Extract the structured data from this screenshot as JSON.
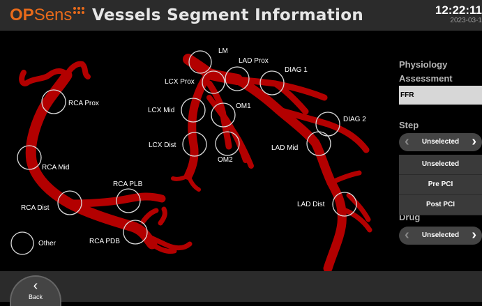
{
  "header": {
    "brand_op": "OP",
    "brand_sens": "Sens",
    "title": "Vessels Segment Information",
    "time": "12:22:11",
    "date": "2023-03-1"
  },
  "segments": [
    {
      "id": "lm",
      "label": "LM"
    },
    {
      "id": "lad-prox",
      "label": "LAD Prox"
    },
    {
      "id": "diag-1",
      "label": "DIAG 1"
    },
    {
      "id": "lcx-prox",
      "label": "LCX Prox"
    },
    {
      "id": "rca-prox",
      "label": "RCA Prox"
    },
    {
      "id": "om1",
      "label": "OM1"
    },
    {
      "id": "lcx-mid",
      "label": "LCX Mid"
    },
    {
      "id": "diag-2",
      "label": "DIAG 2"
    },
    {
      "id": "lcx-dist",
      "label": "LCX Dist"
    },
    {
      "id": "lad-mid",
      "label": "LAD Mid"
    },
    {
      "id": "om2",
      "label": "OM2"
    },
    {
      "id": "rca-mid",
      "label": "RCA Mid"
    },
    {
      "id": "rca-plb",
      "label": "RCA PLB"
    },
    {
      "id": "rca-dist",
      "label": "RCA Dist"
    },
    {
      "id": "lad-dist",
      "label": "LAD Dist"
    },
    {
      "id": "rca-pdb",
      "label": "RCA PDB"
    },
    {
      "id": "other",
      "label": "Other"
    }
  ],
  "panel": {
    "assessment_heading": "Physiology Assessment",
    "assessment_line1": "Physiology",
    "assessment_line2": "Assessment",
    "assessment_value": "FFR",
    "step_heading": "Step",
    "step_value": "Unselected",
    "step_options": [
      "Unselected",
      "Pre PCI",
      "Post PCI"
    ],
    "drug_heading": "Drug",
    "drug_value": "Unselected"
  },
  "footer": {
    "back_label": "Back"
  },
  "colors": {
    "vessel": "#b30000",
    "brand": "#e86a1a"
  },
  "icons": {
    "back": "chevron-left-icon",
    "prev": "chevron-left-icon",
    "next": "chevron-right-icon"
  }
}
